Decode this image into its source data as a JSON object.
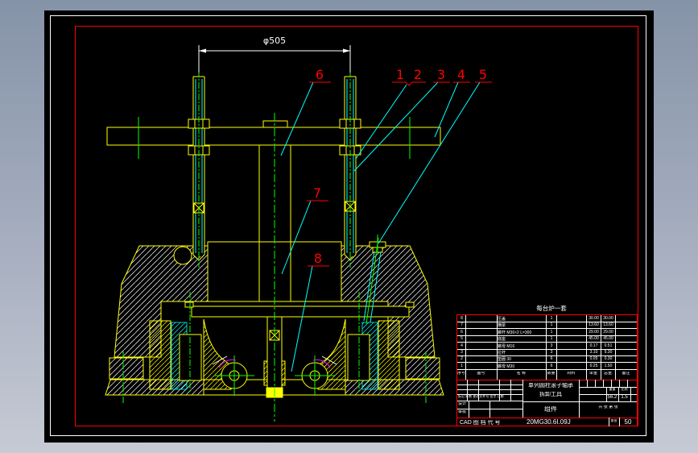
{
  "window": {
    "viewport_bg": "#000000",
    "desktop_top": "#8593a8",
    "desktop_bottom": "#c6cad4"
  },
  "sheet": {
    "outer_frame_color": "#ffffff",
    "inner_frame_color": "#ff0000"
  },
  "palette": {
    "lines_primary": "#ffff00",
    "centerlines": "#00ff00",
    "leaders": "#00ffff",
    "callouts": "#ff0000",
    "dimensions": "#ffffff",
    "arcs": "#ff00ff"
  },
  "dimension": {
    "label": "φ505"
  },
  "drawing_note": "每台炉一套",
  "callouts": [
    {
      "label": "1"
    },
    {
      "label": "2"
    },
    {
      "label": "3"
    },
    {
      "label": "4"
    },
    {
      "label": "5"
    },
    {
      "label": "6"
    },
    {
      "label": "7"
    },
    {
      "label": "8"
    }
  ],
  "parts_header": [
    "序号",
    "图号",
    "名  称",
    "数量",
    "材料",
    "单重",
    "总重",
    "备注"
  ],
  "parts": [
    {
      "no": "8",
      "code": "",
      "name": "压盖",
      "qty": "1",
      "mat": "",
      "unit": "30.00",
      "total": "30.00",
      "note": ""
    },
    {
      "no": "7",
      "code": "",
      "name": "横梁",
      "qty": "1",
      "mat": "",
      "unit": "13.60",
      "total": "13.60",
      "note": ""
    },
    {
      "no": "6",
      "code": "",
      "name": "螺杆 M36×2 L=300",
      "qty": "1",
      "mat": "",
      "unit": "29.00",
      "total": "29.00",
      "note": ""
    },
    {
      "no": "5",
      "code": "",
      "name": "底座",
      "qty": "1",
      "mat": "",
      "unit": "45.00",
      "total": "45.00",
      "note": ""
    },
    {
      "no": "4",
      "code": "",
      "name": "螺母 M16",
      "qty": "3",
      "mat": "",
      "unit": "0.17",
      "total": "0.51",
      "note": ""
    },
    {
      "no": "3",
      "code": "",
      "name": "拉杆",
      "qty": "3",
      "mat": "",
      "unit": "3.10",
      "total": "9.30",
      "note": ""
    },
    {
      "no": "2",
      "code": "",
      "name": "垫圈 30",
      "qty": "6",
      "mat": "",
      "unit": "0.05",
      "total": "0.30",
      "note": ""
    },
    {
      "no": "1",
      "code": "",
      "name": "螺母 M30",
      "qty": "6",
      "mat": "",
      "unit": "0.25",
      "total": "1.50",
      "note": ""
    }
  ],
  "title_block": {
    "product_line1": "单列圆柱滚子轴承",
    "product_line2": "拆卸工具",
    "assembly": "组件",
    "rev_row": "标记 处数 更改文件号 签字 日期",
    "design_label": "设计",
    "check_label": "审核",
    "weight_label": "重量",
    "scale_label": "比例",
    "weight_value": "56.2",
    "scale_value": "1.5",
    "sheets_text": "共 张 第 张",
    "cad_label": "CAD 图 档 代 号",
    "drawing_no": "20MG30.6I.09J",
    "page_label": "第张",
    "page_no": "50"
  }
}
